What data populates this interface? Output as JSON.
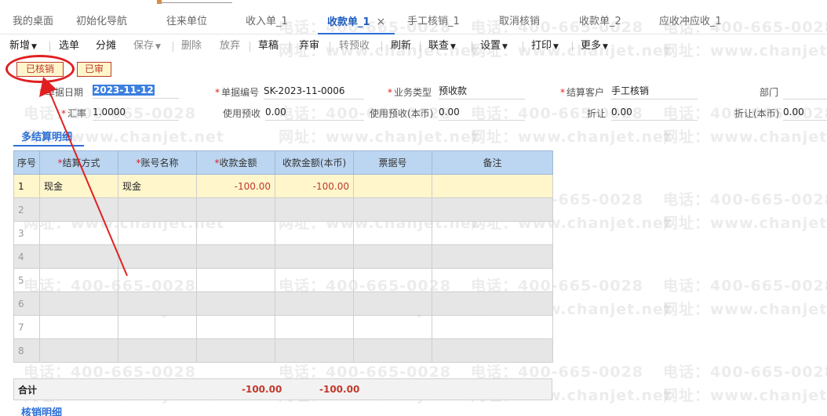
{
  "tabs": [
    {
      "label": "我的桌面"
    },
    {
      "label": "初始化导航"
    },
    {
      "label": "往来单位"
    },
    {
      "label": "收入单_1"
    },
    {
      "label": "收款单_1",
      "active": true
    },
    {
      "label": "手工核销_1"
    },
    {
      "label": "取消核销"
    },
    {
      "label": "收款单_2"
    },
    {
      "label": "应收冲应收_1"
    }
  ],
  "toolbar": {
    "new": "新增",
    "select": "选单",
    "allocate": "分摊",
    "save": "保存",
    "delete": "删除",
    "abandon": "放弃",
    "draft": "草稿",
    "discard": "弃审",
    "to_prepay": "转预收",
    "refresh": "刷新",
    "link_query": "联查",
    "settings": "设置",
    "print": "打印",
    "more": "更多"
  },
  "badges": {
    "verified": "已核销",
    "audited": "已审"
  },
  "form": {
    "date_label": "单据日期",
    "date_value": "2023-11-12",
    "doc_no_label": "单据编号",
    "doc_no_value": "SK-2023-11-0006",
    "biz_type_label": "业务类型",
    "biz_type_value": "预收款",
    "customer_label": "结算客户",
    "customer_value": "手工核销",
    "dept_label": "部门",
    "dept_value": "",
    "rate_label": "汇率",
    "rate_value": "1.0000",
    "use_prepay_label": "使用预收",
    "use_prepay_value": "0.00",
    "use_prepay_local_label": "使用预收(本币)",
    "use_prepay_local_value": "0.00",
    "discount_label": "折让",
    "discount_value": "0.00",
    "discount_local_label": "折让(本币)",
    "discount_local_value": "0.00"
  },
  "section_tab": "多结算明细",
  "grid": {
    "headers": [
      "序号",
      "结算方式",
      "账号名称",
      "收款金额",
      "收款金额(本币)",
      "票据号",
      "备注"
    ],
    "rows": [
      {
        "idx": "1",
        "method": "现金",
        "account": "现金",
        "amount": "-100.00",
        "amount_local": "-100.00",
        "bill_no": "",
        "note": ""
      },
      {
        "idx": "2",
        "method": "",
        "account": "",
        "amount": "",
        "amount_local": "",
        "bill_no": "",
        "note": ""
      },
      {
        "idx": "3",
        "method": "",
        "account": "",
        "amount": "",
        "amount_local": "",
        "bill_no": "",
        "note": ""
      },
      {
        "idx": "4",
        "method": "",
        "account": "",
        "amount": "",
        "amount_local": "",
        "bill_no": "",
        "note": ""
      },
      {
        "idx": "5",
        "method": "",
        "account": "",
        "amount": "",
        "amount_local": "",
        "bill_no": "",
        "note": ""
      },
      {
        "idx": "6",
        "method": "",
        "account": "",
        "amount": "",
        "amount_local": "",
        "bill_no": "",
        "note": ""
      },
      {
        "idx": "7",
        "method": "",
        "account": "",
        "amount": "",
        "amount_local": "",
        "bill_no": "",
        "note": ""
      },
      {
        "idx": "8",
        "method": "",
        "account": "",
        "amount": "",
        "amount_local": "",
        "bill_no": "",
        "note": ""
      }
    ]
  },
  "totals": {
    "label": "合计",
    "amount": "-100.00",
    "amount_local": "-100.00"
  },
  "sub_section": "核销明细",
  "watermark": {
    "phone": "电话：400-665-0028",
    "site": "网址：www.chanjet.net"
  },
  "colors": {
    "accent": "#2b6fd6",
    "negative": "#c0392b",
    "annotation": "#e02020",
    "header_bg": "#bcd6f2",
    "selected_row": "#fff6cc"
  }
}
